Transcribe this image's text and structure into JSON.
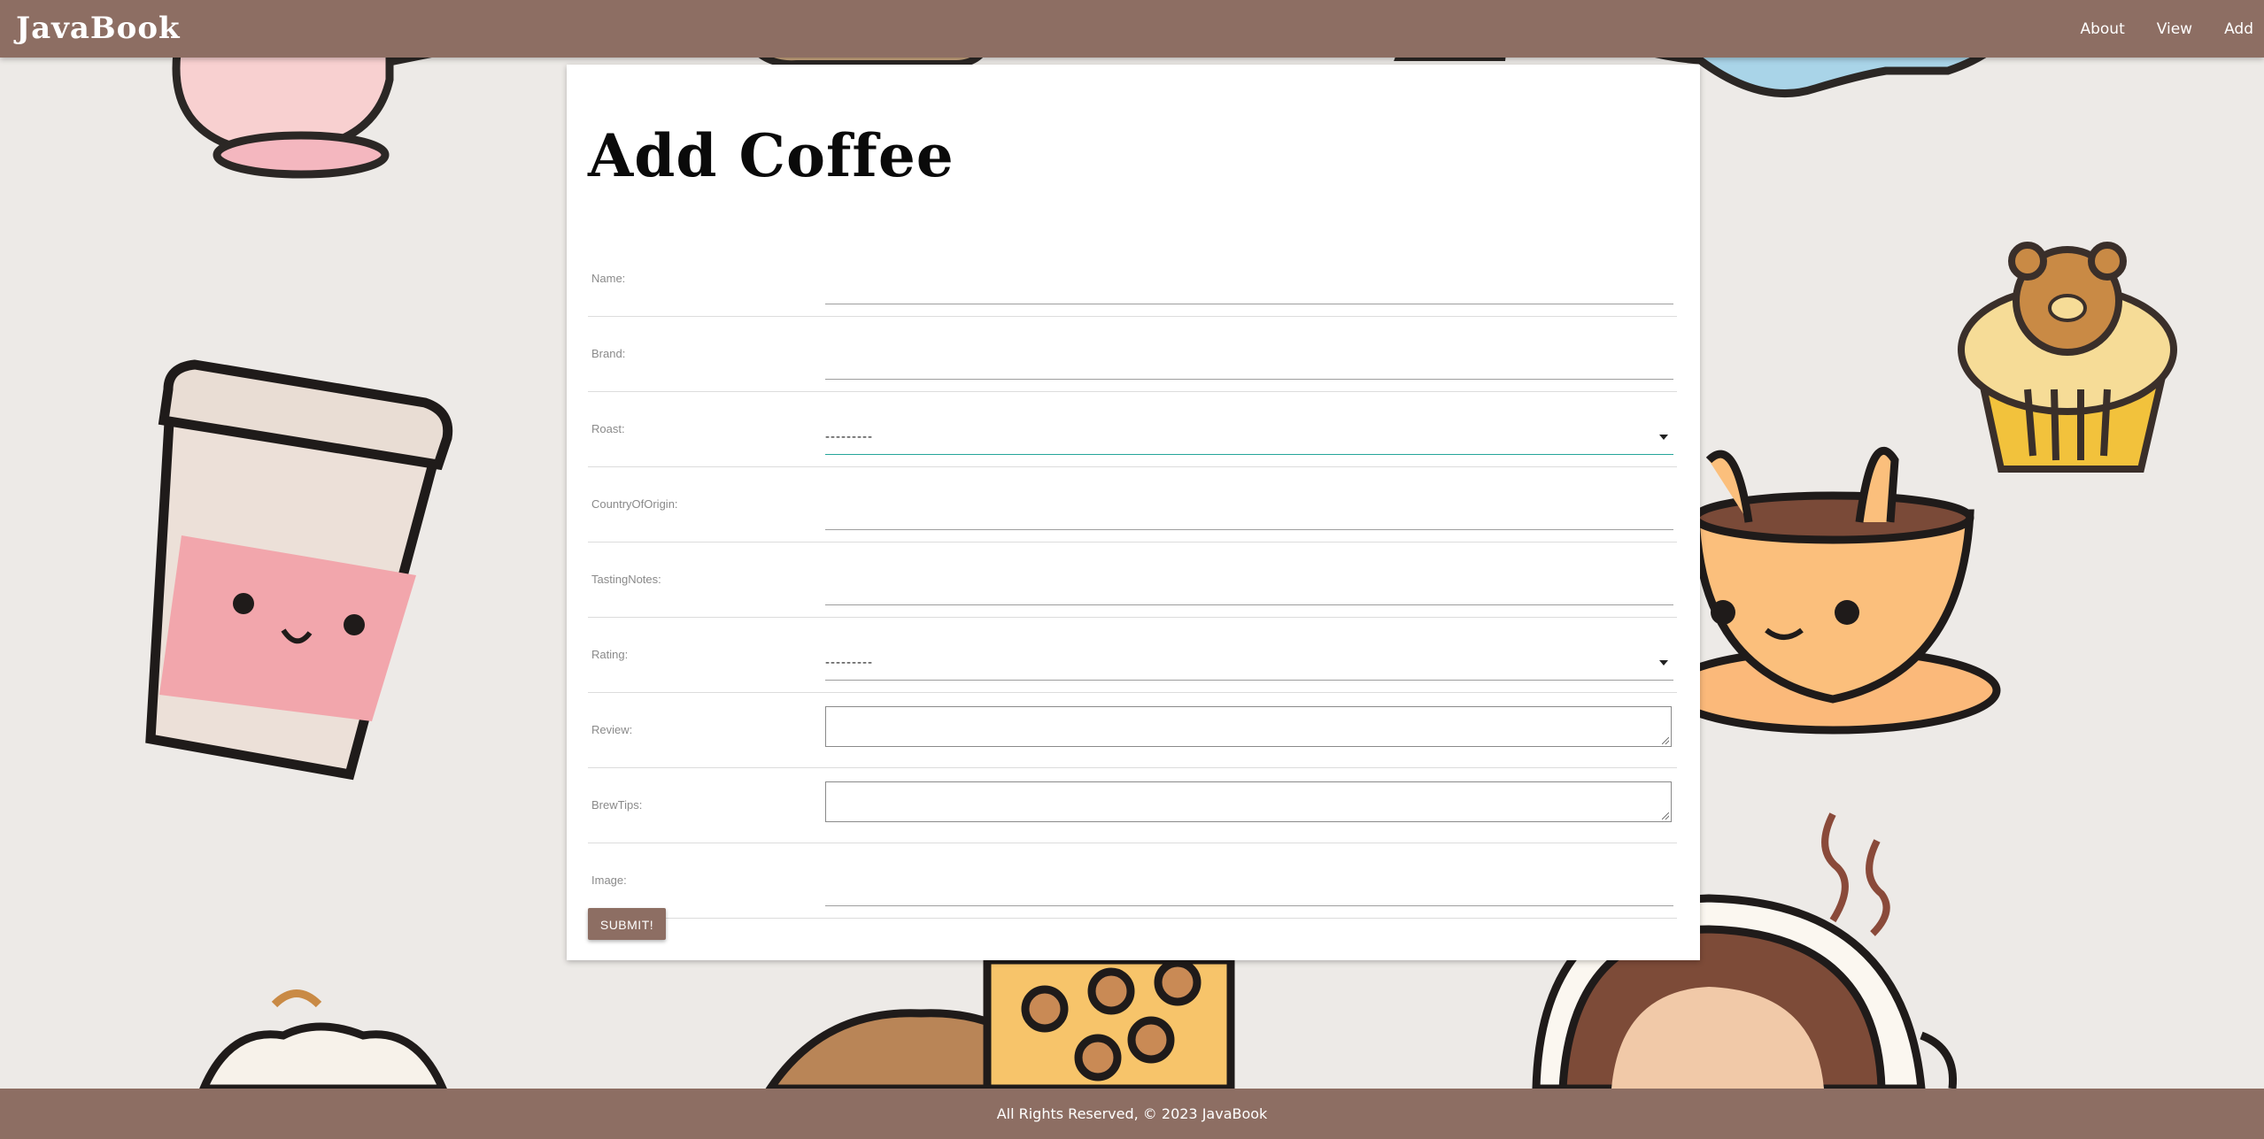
{
  "navbar": {
    "brand": "JavaBook",
    "links": [
      "About",
      "View",
      "Add"
    ]
  },
  "form": {
    "title": "Add Coffee",
    "fields": [
      {
        "label": "Name:",
        "type": "text",
        "value": ""
      },
      {
        "label": "Brand:",
        "type": "text",
        "value": ""
      },
      {
        "label": "Roast:",
        "type": "select",
        "value": "---------"
      },
      {
        "label": "CountryOfOrigin:",
        "type": "text",
        "value": ""
      },
      {
        "label": "TastingNotes:",
        "type": "text",
        "value": ""
      },
      {
        "label": "Rating:",
        "type": "select",
        "value": "---------"
      },
      {
        "label": "Review:",
        "type": "textarea",
        "value": ""
      },
      {
        "label": "BrewTips:",
        "type": "textarea",
        "value": ""
      },
      {
        "label": "Image:",
        "type": "text",
        "value": ""
      }
    ],
    "submit_label": "SUBMIT!"
  },
  "footer": {
    "text": "All Rights Reserved, © 2023 JavaBook"
  },
  "colors": {
    "primary": "#8d6e63",
    "background": "#edeae7",
    "focus": "#26a69a"
  }
}
